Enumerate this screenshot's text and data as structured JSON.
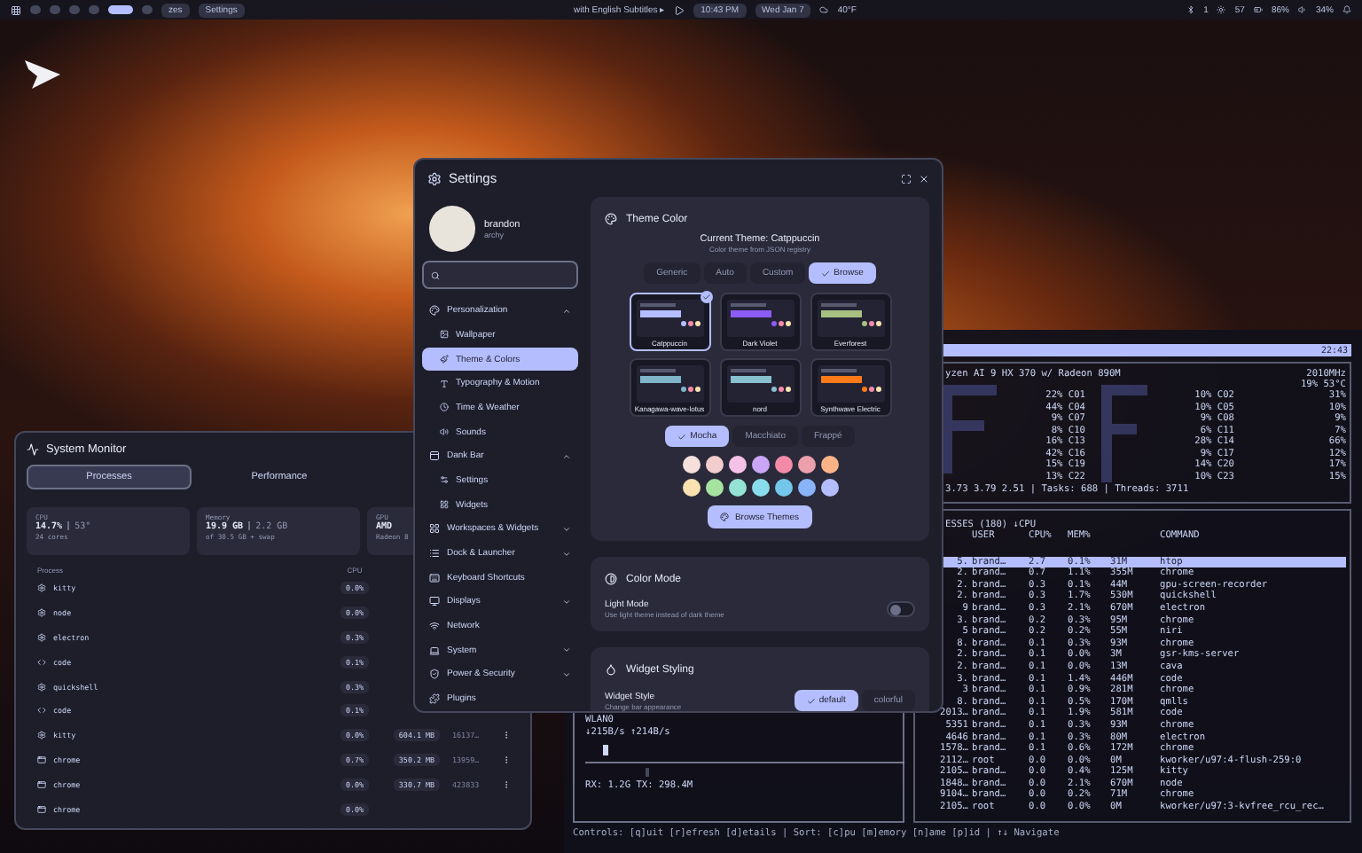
{
  "top_bar": {
    "workspaces": [
      {
        "selected": false
      },
      {
        "selected": false
      },
      {
        "selected": false
      },
      {
        "selected": false
      },
      {
        "selected": true
      },
      {
        "selected": false
      }
    ],
    "window_labels": [
      "zes",
      "Settings"
    ],
    "media": "with English Subtitles ▸",
    "time": "10:43 PM",
    "date": "Wed Jan 7",
    "weather": "40°F",
    "status": [
      "1",
      "57",
      "86%",
      "34%"
    ]
  },
  "settings": {
    "title": "Settings",
    "user": {
      "name": "brandon",
      "host": "archy"
    },
    "sidebar": [
      {
        "kind": "group",
        "label": "Personalization",
        "selected": false,
        "expanded": true,
        "children": [
          {
            "label": "Wallpaper",
            "selected": false
          },
          {
            "label": "Theme & Colors",
            "selected": true
          },
          {
            "label": "Typography & Motion",
            "selected": false
          },
          {
            "label": "Time & Weather",
            "selected": false
          },
          {
            "label": "Sounds",
            "selected": false
          }
        ]
      },
      {
        "kind": "group",
        "label": "Dank Bar",
        "selected": false,
        "expanded": true,
        "children": [
          {
            "label": "Settings",
            "selected": false
          },
          {
            "label": "Widgets",
            "selected": false
          }
        ]
      },
      {
        "kind": "group",
        "label": "Workspaces & Widgets",
        "selected": false,
        "expanded": false
      },
      {
        "kind": "group",
        "label": "Dock & Launcher",
        "selected": false,
        "expanded": false
      },
      {
        "kind": "page",
        "label": "Keyboard Shortcuts",
        "selected": false
      },
      {
        "kind": "group",
        "label": "Displays",
        "selected": false,
        "expanded": false
      },
      {
        "kind": "page",
        "label": "Network",
        "selected": false
      },
      {
        "kind": "group",
        "label": "System",
        "selected": false,
        "expanded": false
      },
      {
        "kind": "group",
        "label": "Power & Security",
        "selected": false,
        "expanded": false
      },
      {
        "kind": "page",
        "label": "Plugins",
        "selected": false
      }
    ],
    "theme_color": {
      "title": "Theme Color",
      "current": "Current Theme: Catppuccin",
      "hint": "Color theme from JSON registry",
      "tabs": [
        {
          "label": "Generic",
          "selected": false
        },
        {
          "label": "Auto",
          "selected": false
        },
        {
          "label": "Custom",
          "selected": false
        },
        {
          "label": "Browse",
          "selected": true
        }
      ],
      "themes": [
        {
          "name": "Catppuccin",
          "color": "#b4befe",
          "selected": true
        },
        {
          "name": "Dark Violet",
          "color": "#8b5cf6",
          "selected": false
        },
        {
          "name": "Everforest",
          "color": "#a7c080",
          "selected": false
        },
        {
          "name": "Kanagawa-wave-lotus",
          "color": "#7fb4ca",
          "selected": false
        },
        {
          "name": "nord",
          "color": "#88c0d0",
          "selected": false
        },
        {
          "name": "Synthwave Electric",
          "color": "#ff7a18",
          "selected": false
        }
      ],
      "variants": [
        {
          "label": "Mocha",
          "selected": true
        },
        {
          "label": "Macchiato",
          "selected": false
        },
        {
          "label": "Frappé",
          "selected": false
        }
      ],
      "swatches": [
        {
          "color": "#f5e0dc"
        },
        {
          "color": "#f2cdcd"
        },
        {
          "color": "#f5c2e7"
        },
        {
          "color": "#cba6f7"
        },
        {
          "color": "#f38ba8"
        },
        {
          "color": "#eba0ac"
        },
        {
          "color": "#fab387"
        },
        {
          "color": "#f9e2af"
        },
        {
          "color": "#a6e3a1"
        },
        {
          "color": "#94e2d5"
        },
        {
          "color": "#89dceb"
        },
        {
          "color": "#74c7ec"
        },
        {
          "color": "#89b4fa"
        },
        {
          "color": "#b4befe"
        }
      ],
      "browse_button": "Browse Themes"
    },
    "color_mode": {
      "title": "Color Mode",
      "label": "Light Mode",
      "hint": "Use light theme instead of dark theme",
      "on": false
    },
    "widget_styling": {
      "title": "Widget Styling",
      "label": "Widget Style",
      "hint": "Change bar appearance",
      "options": [
        {
          "label": "default",
          "selected": true
        },
        {
          "label": "colorful",
          "selected": false
        }
      ]
    }
  },
  "system_monitor": {
    "title": "System Monitor",
    "tabs": [
      {
        "label": "Processes",
        "selected": true
      },
      {
        "label": "Performance",
        "selected": false
      }
    ],
    "stats": [
      {
        "label": "CPU",
        "value": "14.7%",
        "extra": "53°",
        "detail": "24 cores"
      },
      {
        "label": "Memory",
        "value": "19.9 GB",
        "extra": "2.2 GB",
        "detail": "of 30.5 GB + swap"
      },
      {
        "label": "GPU",
        "value": "AMD",
        "detail": "Radeon 8"
      }
    ],
    "columns": [
      "Process",
      "CPU"
    ],
    "rows": [
      {
        "kind": "app",
        "name": "kitty",
        "cpu": "0.0%"
      },
      {
        "kind": "app",
        "name": "node",
        "cpu": "0.0%"
      },
      {
        "kind": "app",
        "name": "electron",
        "cpu": "0.3%"
      },
      {
        "kind": "code",
        "name": "code",
        "cpu": "0.1%"
      },
      {
        "kind": "app",
        "name": "quickshell",
        "cpu": "0.3%"
      },
      {
        "kind": "code",
        "name": "code",
        "cpu": "0.1%"
      },
      {
        "kind": "app",
        "name": "kitty",
        "cpu": "0.0%",
        "memory": "604.1 MB",
        "pid": "16137…"
      },
      {
        "kind": "browser",
        "name": "chrome",
        "cpu": "0.7%",
        "memory": "350.2 MB",
        "pid": "13959…"
      },
      {
        "kind": "browser",
        "name": "chrome",
        "cpu": "0.0%",
        "memory": "330.7 MB",
        "pid": "423833"
      },
      {
        "kind": "browser",
        "name": "chrome",
        "cpu": "0.0%"
      }
    ]
  },
  "terminal": {
    "clock": "22:43",
    "cpu_model": "yzen AI 9 HX 370 w/ Radeon 890M",
    "frequency": "2010MHz",
    "temperature": "19% 53°C",
    "cores": [
      [
        "22% C01",
        "10% C02",
        "31%"
      ],
      [
        "44% C04",
        "10% C05",
        "10%"
      ],
      [
        "9% C07",
        "9% C08",
        "9%"
      ],
      [
        "8% C10",
        "6% C11",
        "7%"
      ],
      [
        "16% C13",
        "28% C14",
        "66%"
      ],
      [
        "42% C16",
        "9% C17",
        "12%"
      ],
      [
        "15% C19",
        "14% C20",
        "17%"
      ],
      [
        "13% C22",
        "10% C23",
        "15%"
      ]
    ],
    "load": "3.73 3.79 2.51 | Tasks: 688 | Threads: 3711",
    "process_title": "ESSES (180) ↓CPU",
    "columns": [
      "USER",
      "CPU%",
      "MEM%",
      "COMMAND"
    ],
    "processes": [
      {
        "pid": "5.",
        "user": "brand…",
        "cpu": "2.7",
        "mem": "0.1%",
        "size": "31M",
        "command": "htop",
        "selected": true
      },
      {
        "pid": "2.",
        "user": "brand…",
        "cpu": "0.7",
        "mem": "1.1%",
        "size": "355M",
        "command": "chrome",
        "selected": false
      },
      {
        "pid": "2.",
        "user": "brand…",
        "cpu": "0.3",
        "mem": "0.1%",
        "size": "44M",
        "command": "gpu-screen-recorder",
        "selected": false
      },
      {
        "pid": "2.",
        "user": "brand…",
        "cpu": "0.3",
        "mem": "1.7%",
        "size": "530M",
        "command": "quickshell",
        "selected": false
      },
      {
        "pid": "9",
        "user": "brand…",
        "cpu": "0.3",
        "mem": "2.1%",
        "size": "670M",
        "command": "electron",
        "selected": false
      },
      {
        "pid": "3.",
        "user": "brand…",
        "cpu": "0.2",
        "mem": "0.3%",
        "size": "95M",
        "command": "chrome",
        "selected": false
      },
      {
        "pid": "5",
        "user": "brand…",
        "cpu": "0.2",
        "mem": "0.2%",
        "size": "55M",
        "command": "niri",
        "selected": false
      },
      {
        "pid": "8.",
        "user": "brand…",
        "cpu": "0.1",
        "mem": "0.3%",
        "size": "93M",
        "command": "chrome",
        "selected": false
      },
      {
        "pid": "2.",
        "user": "brand…",
        "cpu": "0.1",
        "mem": "0.0%",
        "size": "3M",
        "command": "gsr-kms-server",
        "selected": false
      },
      {
        "pid": "2.",
        "user": "brand…",
        "cpu": "0.1",
        "mem": "0.0%",
        "size": "13M",
        "command": "cava",
        "selected": false
      },
      {
        "pid": "3.",
        "user": "brand…",
        "cpu": "0.1",
        "mem": "1.4%",
        "size": "446M",
        "command": "code",
        "selected": false
      },
      {
        "pid": "3",
        "user": "brand…",
        "cpu": "0.1",
        "mem": "0.9%",
        "size": "281M",
        "command": "chrome",
        "selected": false
      },
      {
        "pid": "8.",
        "user": "brand…",
        "cpu": "0.1",
        "mem": "0.5%",
        "size": "170M",
        "command": "qmlls",
        "selected": false
      },
      {
        "pid": "2013…",
        "user": "brand…",
        "cpu": "0.1",
        "mem": "1.9%",
        "size": "581M",
        "command": "code",
        "selected": false
      },
      {
        "pid": "5351",
        "user": "brand…",
        "cpu": "0.1",
        "mem": "0.3%",
        "size": "93M",
        "command": "chrome",
        "selected": false
      },
      {
        "pid": "4646",
        "user": "brand…",
        "cpu": "0.1",
        "mem": "0.3%",
        "size": "80M",
        "command": "electron",
        "selected": false
      },
      {
        "pid": "1578…",
        "user": "brand…",
        "cpu": "0.1",
        "mem": "0.6%",
        "size": "172M",
        "command": "chrome",
        "selected": false
      },
      {
        "pid": "2112…",
        "user": "root",
        "cpu": "0.0",
        "mem": "0.0%",
        "size": "0M",
        "command": "kworker/u97:4-flush-259:0",
        "selected": false
      },
      {
        "pid": "2105…",
        "user": "brand…",
        "cpu": "0.0",
        "mem": "0.4%",
        "size": "125M",
        "command": "kitty",
        "selected": false
      },
      {
        "pid": "1848…",
        "user": "brand…",
        "cpu": "0.0",
        "mem": "2.1%",
        "size": "670M",
        "command": "node",
        "selected": false
      },
      {
        "pid": "9104…",
        "user": "brand…",
        "cpu": "0.0",
        "mem": "0.2%",
        "size": "71M",
        "command": "chrome",
        "selected": false
      },
      {
        "pid": "2105…",
        "user": "root",
        "cpu": "0.0",
        "mem": "0.0%",
        "size": "0M",
        "command": "kworker/u97:3-kvfree_rcu_rec…",
        "selected": false
      }
    ],
    "network": {
      "interface": "WLAN0",
      "rate": "↓215B/s ↑214B/s",
      "totals": "RX: 1.2G TX: 298.4M"
    },
    "controls": "Controls: [q]uit [r]efresh [d]etails | Sort: [c]pu [m]emory [n]ame [p]id | ↑↓ Navigate"
  }
}
